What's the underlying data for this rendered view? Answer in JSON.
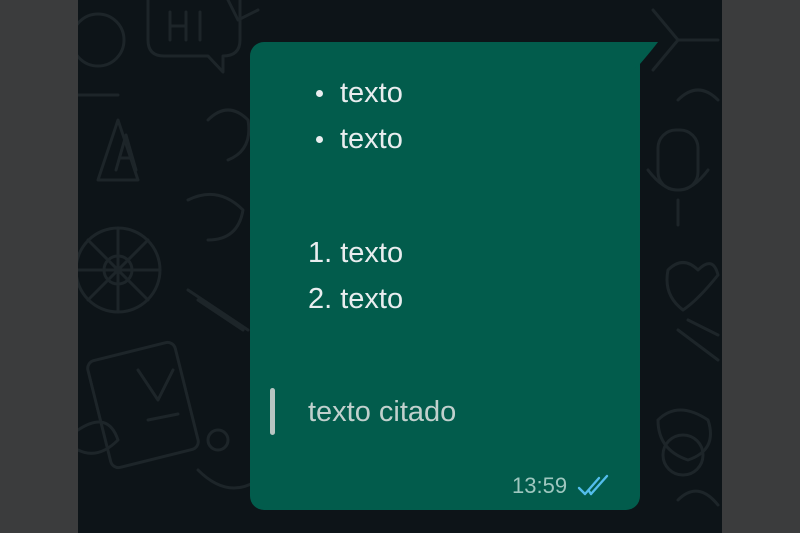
{
  "message": {
    "bullet_items": [
      "texto",
      "texto"
    ],
    "numbered_items": [
      "1. texto",
      "2. texto"
    ],
    "quote_text": "texto citado",
    "timestamp": "13:59",
    "status_icon": "double-check-read-icon"
  },
  "colors": {
    "bubble": "#025c4c",
    "chat_background": "#0d1418",
    "read_ticks": "#53bdeb"
  }
}
